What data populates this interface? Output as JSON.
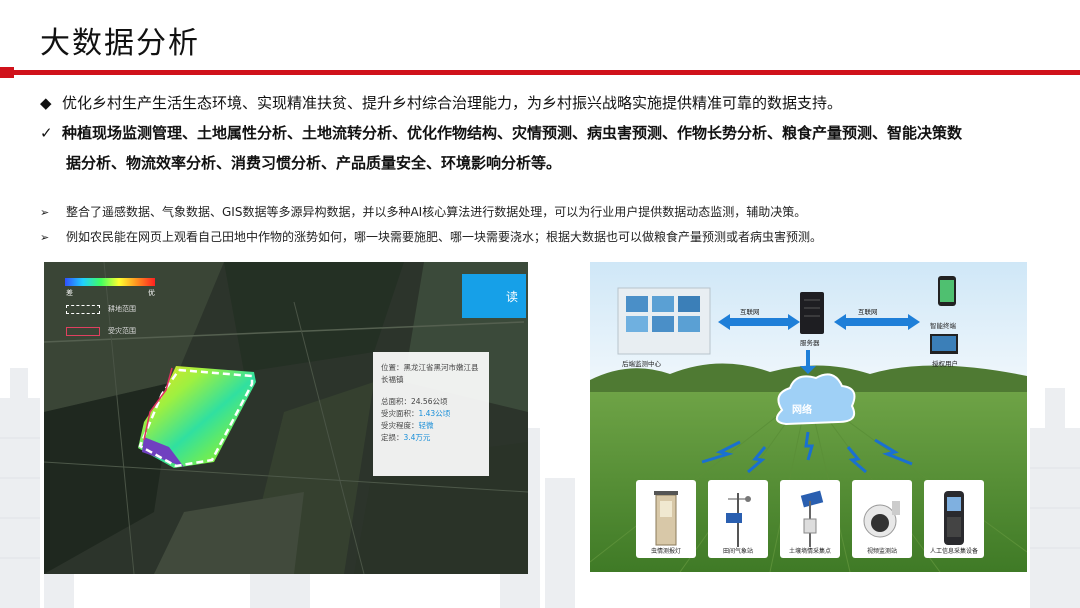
{
  "slide": {
    "title": "大数据分析",
    "bullet_main": "优化乡村生产生活生态环境、实现精准扶贫、提升乡村综合治理能力，为乡村振兴战略实施提供精准可靠的数据支持。",
    "check_line_1": "种植现场监测管理、土地属性分析、土地流转分析、优化作物结构、灾情预测、病虫害预测、作物长势分析、粮食产量预测、智能决策数",
    "check_line_2": "据分析、物流效率分析、消费习惯分析、产品质量安全、环境影响分析等。",
    "sub_bullet_1": "整合了遥感数据、气象数据、GIS数据等多源异构数据，并以多种AI核心算法进行数据处理，可以为行业用户提供数据动态监测，辅助决策。",
    "sub_bullet_2": "例如农民能在网页上观看自己田地中作物的涨势如何，哪一块需要施肥、哪一块需要浇水；根据大数据也可以做粮食产量预测或者病虫害预测。",
    "marks": {
      "diamond": "◆",
      "check": "✓",
      "arrow": "➢"
    },
    "accent_color": "#d0121b"
  },
  "satellite_panel": {
    "legend_low": "差",
    "legend_high": "优",
    "legend_plot": "耕地范围",
    "legend_disaster": "受灾范围",
    "button_text": "读",
    "location": "位置：黑龙江省黑河市嫩江县长福镇",
    "total_area": "总面积：24.56公顷",
    "affected_area_label": "受灾面积：",
    "affected_area_value": "1.43公顷",
    "severity_label": "受灾程度：",
    "severity_value": "轻微",
    "loss_label": "定损：",
    "loss_value": "3.4万元"
  },
  "network_diagram": {
    "center_label": "后端监测中心",
    "internet_left": "互联网",
    "internet_right": "互联网",
    "server_label": "服务器",
    "terminal_label": "智能终端",
    "user_label": "授权用户",
    "network_label": "网络",
    "devices": [
      "虫情测报灯",
      "田间气象站",
      "土壤墒情采集点",
      "视频监测站",
      "人工信息采集设备"
    ]
  }
}
